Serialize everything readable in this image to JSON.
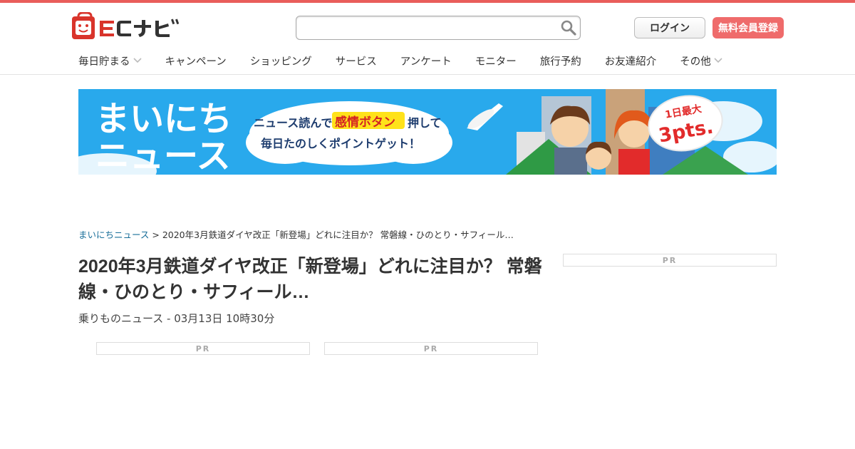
{
  "header": {
    "logo_text": "ECナビ",
    "search": {
      "value": "",
      "placeholder": ""
    },
    "login_label": "ログイン",
    "register_label": "無料会員登録"
  },
  "nav": {
    "items": [
      {
        "label": "毎日貯まる",
        "dropdown": true
      },
      {
        "label": "キャンペーン",
        "dropdown": false
      },
      {
        "label": "ショッピング",
        "dropdown": false
      },
      {
        "label": "サービス",
        "dropdown": false
      },
      {
        "label": "アンケート",
        "dropdown": false
      },
      {
        "label": "モニター",
        "dropdown": false
      },
      {
        "label": "旅行予約",
        "dropdown": false
      },
      {
        "label": "お友達紹介",
        "dropdown": false
      },
      {
        "label": "その他",
        "dropdown": true
      }
    ]
  },
  "banner": {
    "title_line1": "まいにち",
    "title_line2": "ニュース",
    "tagline_pre": "ニュース読んで",
    "tagline_button": "感情ボタン",
    "tagline_post": "押して",
    "tagline_line2": "毎日たのしくポイントゲット！",
    "badge_line1": "1日最大",
    "badge_line2": "3pts."
  },
  "breadcrumb": {
    "root": "まいにちニュース",
    "separator": " > ",
    "current": "2020年3月鉄道ダイヤ改正「新登場」どれに注目か？ 常磐線・ひのとり・サフィール…"
  },
  "article": {
    "title": "2020年3月鉄道ダイヤ改正「新登場」どれに注目か？ 常磐線・ひのとり・サフィール…",
    "meta": "乗りものニュース - 03月13日 10時30分"
  },
  "ads": {
    "pr_label": "PR"
  },
  "colors": {
    "accent": "#e95d5b",
    "register_bg": "#ef6b6b",
    "link": "#1a6f9a",
    "banner_sky": "#29a9ec"
  }
}
